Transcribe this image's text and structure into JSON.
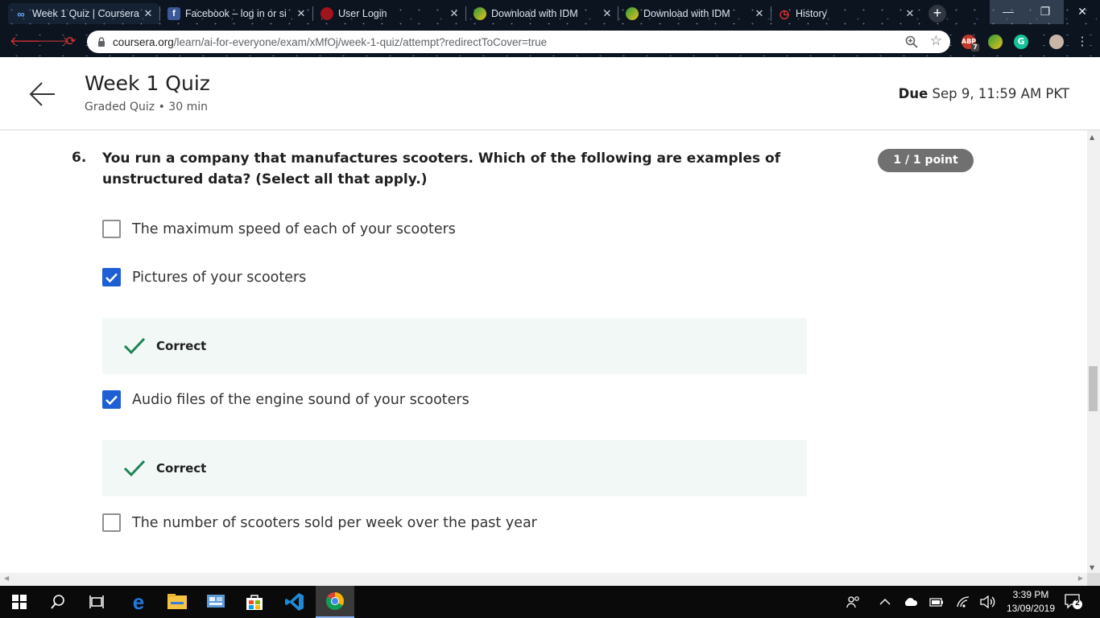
{
  "browser": {
    "tabs": [
      {
        "title": "Week 1 Quiz | Coursera",
        "icon": "coursera-icon",
        "active": true
      },
      {
        "title": "Facebook – log in or si",
        "icon": "facebook-icon",
        "active": false
      },
      {
        "title": "User Login",
        "icon": "user-login-icon",
        "active": false
      },
      {
        "title": "Download with IDM",
        "icon": "idm-icon",
        "active": false
      },
      {
        "title": "Download with IDM",
        "icon": "idm-icon",
        "active": false
      },
      {
        "title": "History",
        "icon": "history-icon",
        "active": false
      }
    ],
    "new_tab": "+",
    "url_domain": "coursera.org",
    "url_path": "/learn/ai-for-everyone/exam/xMfOj/week-1-quiz/attempt?redirectToCover=true",
    "extensions": [
      {
        "name": "adblock-icon",
        "badge": "7"
      },
      {
        "name": "idm-extension-icon"
      },
      {
        "name": "grammarly-icon"
      },
      {
        "name": "profile-avatar-icon"
      }
    ]
  },
  "header": {
    "title": "Week 1 Quiz",
    "subtitle": "Graded Quiz • 30 min",
    "due_label": "Due",
    "due_value": "Sep 9, 11:59 AM PKT"
  },
  "question": {
    "number": "6.",
    "text": "You run a company that manufactures scooters. Which of the following are examples of unstructured data? (Select all that apply.)",
    "points": "1 / 1 point",
    "options": [
      {
        "label": "The maximum speed of each of your scooters",
        "checked": false
      },
      {
        "label": "Pictures of your scooters",
        "checked": true,
        "feedback": "Correct"
      },
      {
        "label": "Audio files of the engine sound of your scooters",
        "checked": true,
        "feedback": "Correct"
      },
      {
        "label": "The number of scooters sold per week over the past year",
        "checked": false
      }
    ]
  },
  "taskbar": {
    "apps": [
      "windows-start-icon",
      "search-icon",
      "task-view-icon",
      "edge-icon",
      "file-explorer-icon",
      "control-panel-icon",
      "store-icon",
      "vscode-icon",
      "chrome-icon"
    ],
    "time": "3:39 PM",
    "date": "13/09/2019",
    "notifications": "2"
  },
  "colors": {
    "checkbox_checked": "#1f5fd6",
    "correct_green": "#1f8354",
    "feedback_bg": "#f2f8f6",
    "points_badge": "#707070"
  }
}
